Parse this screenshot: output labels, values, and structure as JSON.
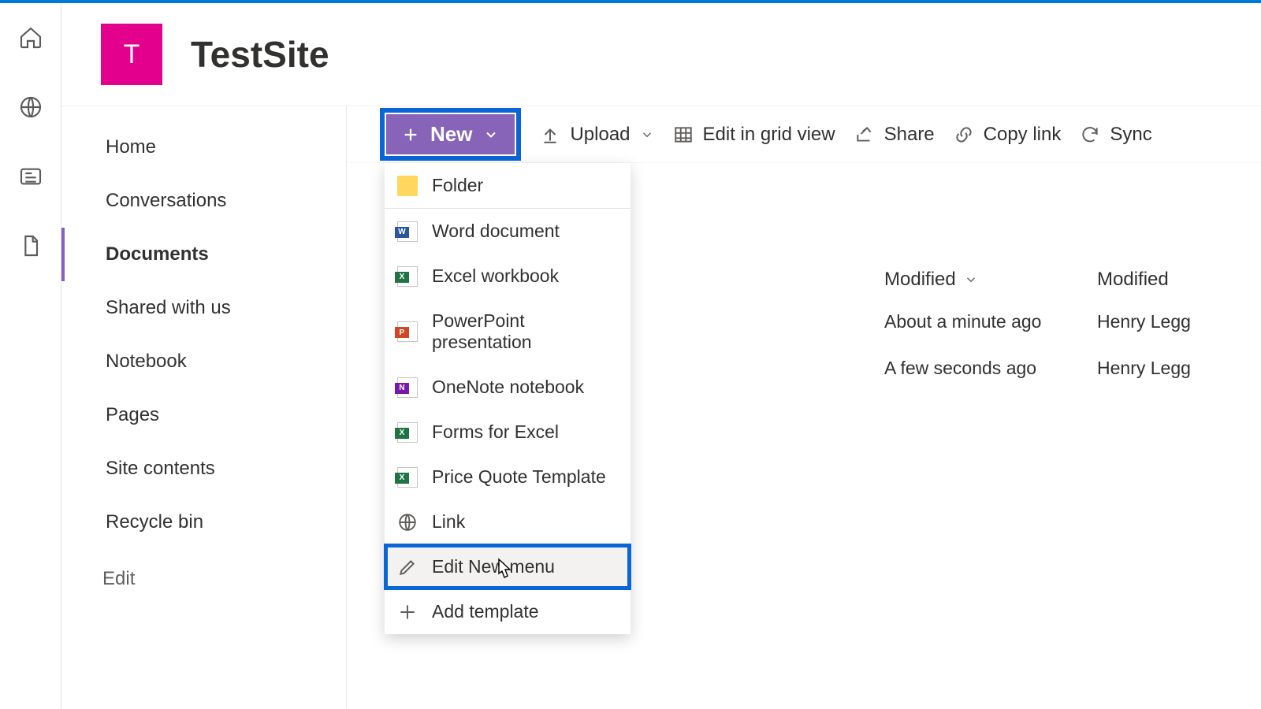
{
  "site": {
    "logo_letter": "T",
    "title": "TestSite"
  },
  "sidenav": {
    "items": [
      {
        "label": "Home"
      },
      {
        "label": "Conversations"
      },
      {
        "label": "Documents",
        "active": true
      },
      {
        "label": "Shared with us"
      },
      {
        "label": "Notebook"
      },
      {
        "label": "Pages"
      },
      {
        "label": "Site contents"
      },
      {
        "label": "Recycle bin"
      }
    ],
    "edit_label": "Edit"
  },
  "commands": {
    "new_label": "New",
    "upload_label": "Upload",
    "grid_label": "Edit in grid view",
    "share_label": "Share",
    "copylink_label": "Copy link",
    "sync_label": "Sync"
  },
  "new_menu": {
    "items": [
      {
        "label": "Folder",
        "icon": "folder",
        "sep": true
      },
      {
        "label": "Word document",
        "icon": "word"
      },
      {
        "label": "Excel workbook",
        "icon": "excel"
      },
      {
        "label": "PowerPoint presentation",
        "icon": "ppt"
      },
      {
        "label": "OneNote notebook",
        "icon": "onenote"
      },
      {
        "label": "Forms for Excel",
        "icon": "excel"
      },
      {
        "label": "Price Quote Template",
        "icon": "excel"
      },
      {
        "label": "Link",
        "icon": "link"
      },
      {
        "label": "Edit New menu",
        "icon": "pencil",
        "highlight": true
      },
      {
        "label": "Add template",
        "icon": "plus"
      }
    ]
  },
  "columns": {
    "modified": "Modified",
    "modified_by": "Modified"
  },
  "rows": [
    {
      "modified": "About a minute ago",
      "by": "Henry Legg"
    },
    {
      "modified": "A few seconds ago",
      "by": "Henry Legg"
    }
  ]
}
